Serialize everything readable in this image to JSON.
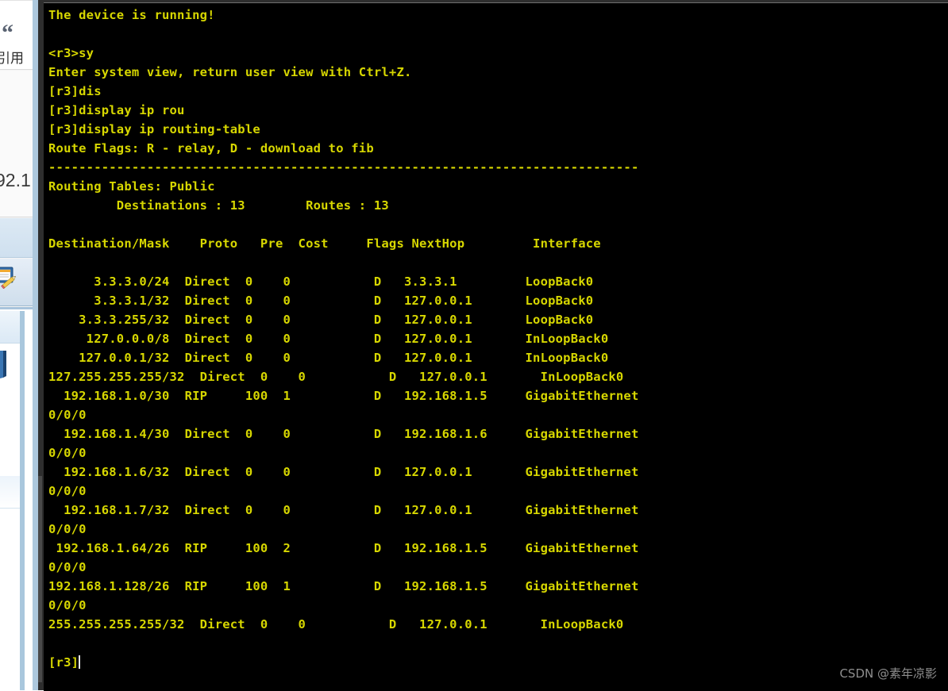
{
  "left_panel": {
    "quote_glyph": "“",
    "quote_label": "引用",
    "ip_fragment": "92.1",
    "note_icon_name": "note-edit-icon",
    "folder_icon_name": "folder-icon"
  },
  "terminal": {
    "prompt_host_user": "<r3>",
    "prompt_system": "[r3]",
    "cursor": "block",
    "fg_color": "#d7d700",
    "bg_color": "#000000",
    "lines": [
      "The device is running!",
      "",
      "<r3>sy",
      "Enter system view, return user view with Ctrl+Z.",
      "[r3]dis",
      "[r3]display ip rou",
      "[r3]display ip routing-table",
      "Route Flags: R - relay, D - download to fib",
      "------------------------------------------------------------------------------",
      "Routing Tables: Public",
      "         Destinations : 13        Routes : 13",
      "",
      "Destination/Mask    Proto   Pre  Cost     Flags NextHop         Interface",
      "",
      "      3.3.3.0/24  Direct  0    0           D   3.3.3.1         LoopBack0",
      "      3.3.3.1/32  Direct  0    0           D   127.0.0.1       LoopBack0",
      "    3.3.3.255/32  Direct  0    0           D   127.0.0.1       LoopBack0",
      "     127.0.0.0/8  Direct  0    0           D   127.0.0.1       InLoopBack0",
      "    127.0.0.1/32  Direct  0    0           D   127.0.0.1       InLoopBack0",
      "127.255.255.255/32  Direct  0    0           D   127.0.0.1       InLoopBack0",
      "  192.168.1.0/30  RIP     100  1           D   192.168.1.5     GigabitEthernet",
      "0/0/0",
      "  192.168.1.4/30  Direct  0    0           D   192.168.1.6     GigabitEthernet",
      "0/0/0",
      "  192.168.1.6/32  Direct  0    0           D   127.0.0.1       GigabitEthernet",
      "0/0/0",
      "  192.168.1.7/32  Direct  0    0           D   127.0.0.1       GigabitEthernet",
      "0/0/0",
      " 192.168.1.64/26  RIP     100  2           D   192.168.1.5     GigabitEthernet",
      "0/0/0",
      "192.168.1.128/26  RIP     100  1           D   192.168.1.5     GigabitEthernet",
      "0/0/0",
      "255.255.255.255/32  Direct  0    0           D   127.0.0.1       InLoopBack0",
      "",
      "[r3]"
    ],
    "header_line": "The device is running!",
    "route_flags": "Route Flags: R - relay, D - download to fib",
    "routing_tables_label": "Routing Tables: Public",
    "destinations_count": "13",
    "routes_count": "13",
    "columns": [
      "Destination/Mask",
      "Proto",
      "Pre",
      "Cost",
      "Flags",
      "NextHop",
      "Interface"
    ],
    "routes": [
      {
        "destination": "3.3.3.0/24",
        "proto": "Direct",
        "pre": "0",
        "cost": "0",
        "flags": "D",
        "nexthop": "3.3.3.1",
        "interface": "LoopBack0"
      },
      {
        "destination": "3.3.3.1/32",
        "proto": "Direct",
        "pre": "0",
        "cost": "0",
        "flags": "D",
        "nexthop": "127.0.0.1",
        "interface": "LoopBack0"
      },
      {
        "destination": "3.3.3.255/32",
        "proto": "Direct",
        "pre": "0",
        "cost": "0",
        "flags": "D",
        "nexthop": "127.0.0.1",
        "interface": "LoopBack0"
      },
      {
        "destination": "127.0.0.0/8",
        "proto": "Direct",
        "pre": "0",
        "cost": "0",
        "flags": "D",
        "nexthop": "127.0.0.1",
        "interface": "InLoopBack0"
      },
      {
        "destination": "127.0.0.1/32",
        "proto": "Direct",
        "pre": "0",
        "cost": "0",
        "flags": "D",
        "nexthop": "127.0.0.1",
        "interface": "InLoopBack0"
      },
      {
        "destination": "127.255.255.255/32",
        "proto": "Direct",
        "pre": "0",
        "cost": "0",
        "flags": "D",
        "nexthop": "127.0.0.1",
        "interface": "InLoopBack0"
      },
      {
        "destination": "192.168.1.0/30",
        "proto": "RIP",
        "pre": "100",
        "cost": "1",
        "flags": "D",
        "nexthop": "192.168.1.5",
        "interface": "GigabitEthernet0/0/0"
      },
      {
        "destination": "192.168.1.4/30",
        "proto": "Direct",
        "pre": "0",
        "cost": "0",
        "flags": "D",
        "nexthop": "192.168.1.6",
        "interface": "GigabitEthernet0/0/0"
      },
      {
        "destination": "192.168.1.6/32",
        "proto": "Direct",
        "pre": "0",
        "cost": "0",
        "flags": "D",
        "nexthop": "127.0.0.1",
        "interface": "GigabitEthernet0/0/0"
      },
      {
        "destination": "192.168.1.7/32",
        "proto": "Direct",
        "pre": "0",
        "cost": "0",
        "flags": "D",
        "nexthop": "127.0.0.1",
        "interface": "GigabitEthernet0/0/0"
      },
      {
        "destination": "192.168.1.64/26",
        "proto": "RIP",
        "pre": "100",
        "cost": "2",
        "flags": "D",
        "nexthop": "192.168.1.5",
        "interface": "GigabitEthernet0/0/0"
      },
      {
        "destination": "192.168.1.128/26",
        "proto": "RIP",
        "pre": "100",
        "cost": "1",
        "flags": "D",
        "nexthop": "192.168.1.5",
        "interface": "GigabitEthernet0/0/0"
      },
      {
        "destination": "255.255.255.255/32",
        "proto": "Direct",
        "pre": "0",
        "cost": "0",
        "flags": "D",
        "nexthop": "127.0.0.1",
        "interface": "InLoopBack0"
      }
    ]
  },
  "watermark": {
    "text": "CSDN @素年凉影"
  }
}
